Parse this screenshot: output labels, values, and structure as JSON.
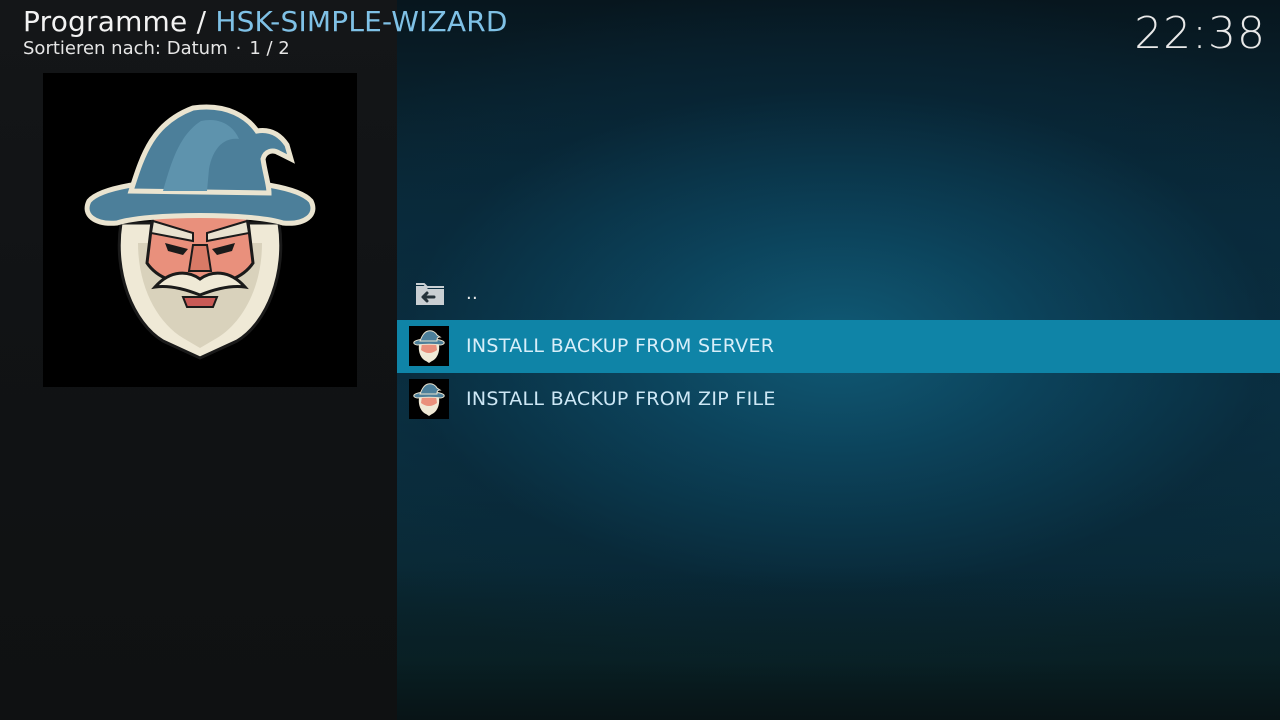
{
  "header": {
    "section": "Programme",
    "separator": "/",
    "current": "HSK-SIMPLE-WIZARD",
    "sort_label": "Sortieren nach: Datum",
    "dot": "·",
    "page": "1 / 2"
  },
  "clock": "22:38",
  "list": {
    "items": [
      {
        "label": "..",
        "icon": "folder-back-icon"
      },
      {
        "label": "INSTALL BACKUP FROM SERVER",
        "icon": "wizard-thumb-icon"
      },
      {
        "label": "INSTALL BACKUP FROM ZIP FILE",
        "icon": "wizard-thumb-icon"
      }
    ],
    "focused_index": 1
  },
  "colors": {
    "accent": "#0f84a7",
    "breadcrumb_current": "#7fc1e6"
  }
}
